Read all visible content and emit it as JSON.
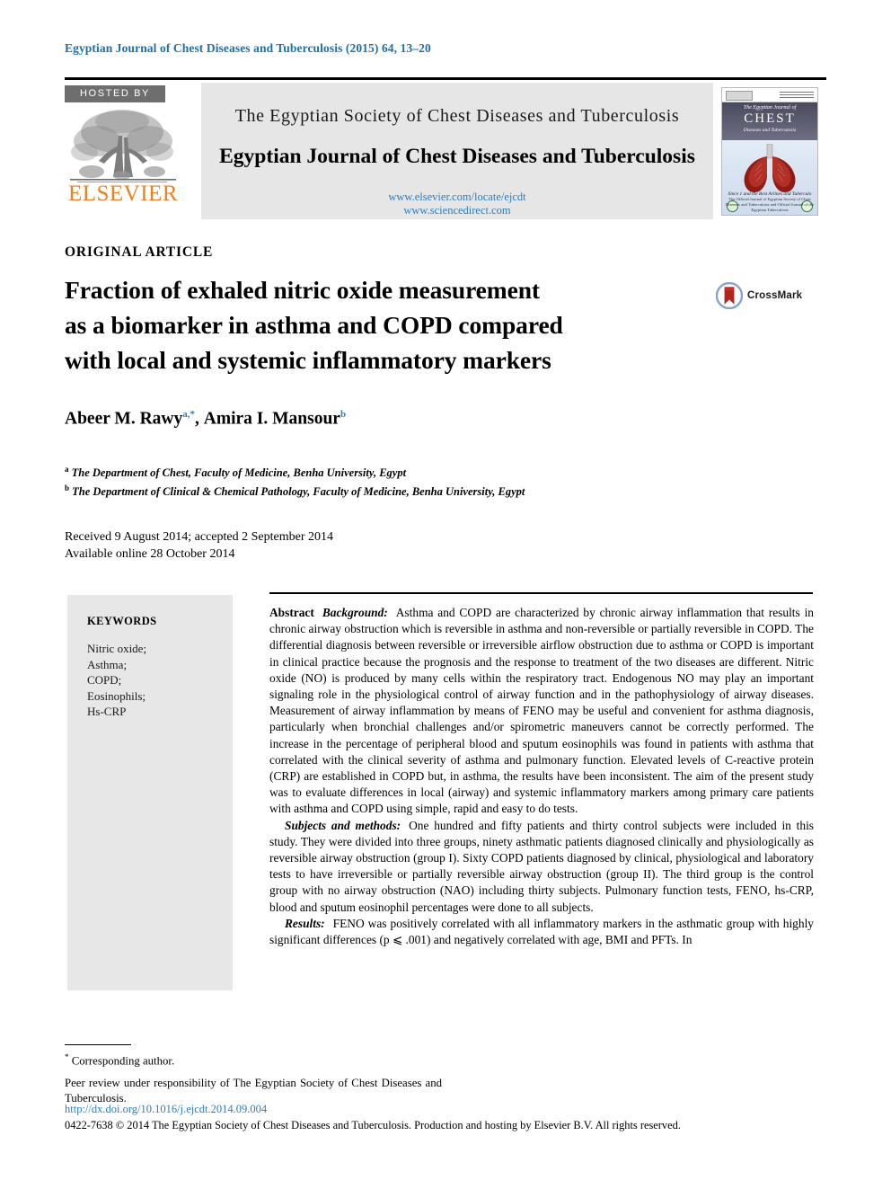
{
  "running_head": "Egyptian Journal of Chest Diseases and Tuberculosis (2015) 64, 13–20",
  "banner": {
    "hosted_by": "HOSTED BY",
    "publisher_name": "ELSEVIER",
    "society_line": "The Egyptian Society of Chest Diseases and Tuberculosis",
    "journal_line": "Egyptian Journal of Chest Diseases and Tuberculosis",
    "url_elsevier": "www.elsevier.com/locate/ejcdt",
    "url_sciencedirect": "www.sciencedirect.com",
    "cover": {
      "line1": "The Egyptian Journal of",
      "line2": "CHEST",
      "line3": "Diseases and Tuberculosis",
      "foot_em": "Since 1 and the Best Arlines and Tuberculo",
      "foot_sub": "The Official Journal of Egyptian Society of Chest Diseases and Tuberculosis and Official Journal of the Egyptian Tuberculosis"
    }
  },
  "article": {
    "type": "ORIGINAL ARTICLE",
    "title_line1": "Fraction of exhaled nitric oxide measurement",
    "title_line2": "as a biomarker in asthma and COPD compared",
    "title_line3": "with local and systemic inflammatory markers",
    "crossmark_label": "CrossMark",
    "authors": [
      {
        "name": "Abeer M. Rawy",
        "marks": "a,*"
      },
      {
        "name": "Amira I. Mansour",
        "marks": "b"
      }
    ],
    "affiliations": [
      {
        "mark": "a",
        "text": "The Department of Chest, Faculty of Medicine, Benha University, Egypt"
      },
      {
        "mark": "b",
        "text": "The Department of Clinical & Chemical Pathology, Faculty of Medicine, Benha University, Egypt"
      }
    ],
    "received_line": "Received 9 August 2014; accepted 2 September 2014",
    "available_line": "Available online 28 October 2014"
  },
  "keywords": {
    "heading": "KEYWORDS",
    "items": "Nitric oxide; Asthma; COPD; Eosinophils; Hs-CRP",
    "list": [
      "Nitric oxide;",
      "Asthma;",
      "COPD;",
      "Eosinophils;",
      "Hs-CRP"
    ]
  },
  "abstract": {
    "label": "Abstract",
    "background_label": "Background:",
    "background_text": "Asthma and COPD are characterized by chronic airway inflammation that results in chronic airway obstruction which is reversible in asthma and non-reversible or partially reversible in COPD. The differential diagnosis between reversible or irreversible airflow obstruction due to asthma or COPD is important in clinical practice because the prognosis and the response to treatment of the two diseases are different. Nitric oxide (NO) is produced by many cells within the respiratory tract. Endogenous NO may play an important signaling role in the physiological control of airway function and in the pathophysiology of airway diseases. Measurement of airway inflammation by means of FENO may be useful and convenient for asthma diagnosis, particularly when bronchial challenges and/or spirometric maneuvers cannot be correctly performed. The increase in the percentage of peripheral blood and sputum eosinophils was found in patients with asthma that correlated with the clinical severity of asthma and pulmonary function. Elevated levels of C-reactive protein (CRP) are established in COPD but, in asthma, the results have been inconsistent. The aim of the present study was to evaluate differences in local (airway) and systemic inflammatory markers among primary care patients with asthma and COPD using simple, rapid and easy to do tests.",
    "methods_label": "Subjects and methods:",
    "methods_text": "One hundred and fifty patients and thirty control subjects were included in this study. They were divided into three groups, ninety asthmatic patients diagnosed clinically and physiologically as reversible airway obstruction (group I). Sixty COPD patients diagnosed by clinical, physiological and laboratory tests to have irreversible or partially reversible airway obstruction (group II). The third group is the control group with no airway obstruction (NAO) including thirty subjects. Pulmonary function tests, FENO, hs-CRP, blood and sputum eosinophil percentages were done to all subjects.",
    "results_label": "Results:",
    "results_text": "FENO was positively correlated with all inflammatory markers in the asthmatic group with highly significant differences (p ⩽ .001) and negatively correlated with age, BMI and PFTs. In"
  },
  "footer": {
    "corresponding_mark": "*",
    "corresponding_text": "Corresponding author.",
    "peer_review": "Peer review under responsibility of The Egyptian Society of Chest Diseases and Tuberculosis.",
    "doi": "http://dx.doi.org/10.1016/j.ejcdt.2014.09.004",
    "copyright": "0422-7638 © 2014 The Egyptian Society of Chest Diseases and Tuberculosis. Production and hosting by Elsevier B.V. All rights reserved."
  },
  "colors": {
    "link": "#2b7fc0",
    "running_head": "#1f6fa8",
    "elsevier_orange": "#ef7f1a",
    "keyword_box": "#e7e7e7",
    "banner_panel": "#e6e6e6"
  }
}
